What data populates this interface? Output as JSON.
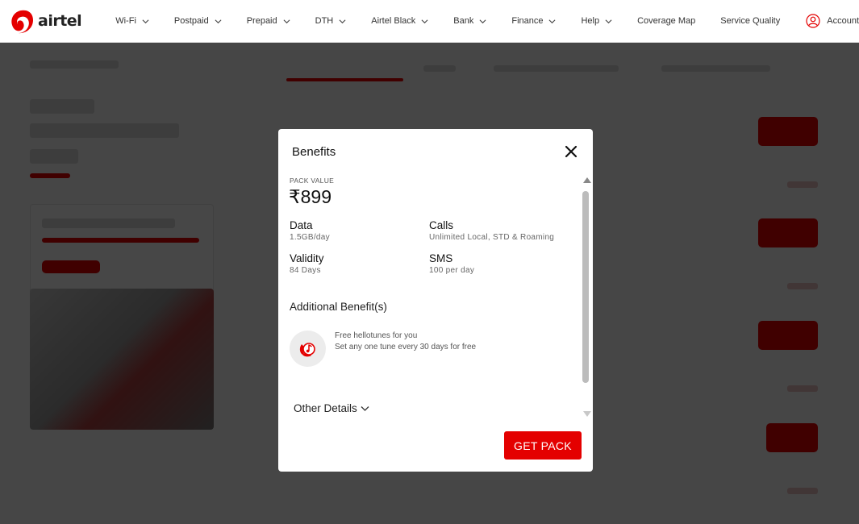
{
  "header": {
    "brand": "airtel",
    "nav": [
      {
        "label": "Wi-Fi",
        "has_dropdown": true
      },
      {
        "label": "Postpaid",
        "has_dropdown": true
      },
      {
        "label": "Prepaid",
        "has_dropdown": true
      },
      {
        "label": "DTH",
        "has_dropdown": true
      },
      {
        "label": "Airtel Black",
        "has_dropdown": true
      },
      {
        "label": "Bank",
        "has_dropdown": true
      },
      {
        "label": "Finance",
        "has_dropdown": true
      },
      {
        "label": "Help",
        "has_dropdown": true
      },
      {
        "label": "Coverage Map",
        "has_dropdown": false
      },
      {
        "label": "Service Quality",
        "has_dropdown": false
      }
    ],
    "account_label": "Account",
    "icons": {
      "logo": "airtel-logo-icon",
      "account": "user-icon",
      "dropdown": "chevron-down-icon"
    }
  },
  "modal": {
    "title": "Benefits",
    "pack_value_label": "PACK VALUE",
    "pack_price": "₹899",
    "benefits": {
      "data": {
        "title": "Data",
        "value": "1.5GB/day"
      },
      "calls": {
        "title": "Calls",
        "value": "Unlimited Local, STD & Roaming"
      },
      "validity": {
        "title": "Validity",
        "value": "84 Days"
      },
      "sms": {
        "title": "SMS",
        "value": "100 per day"
      }
    },
    "additional_title": "Additional Benefit(s)",
    "hellotune": {
      "line1": "Free hellotunes for you",
      "line2": "Set any one tune every 30 days for free"
    },
    "other_details_label": "Other Details",
    "get_pack_label": "GET PACK",
    "icons": {
      "close": "close-icon",
      "hellotune": "hellotune-icon",
      "expand": "chevron-down-icon"
    }
  },
  "colors": {
    "brand_red": "#e40000",
    "overlay": "rgba(0,0,0,0.72)"
  }
}
